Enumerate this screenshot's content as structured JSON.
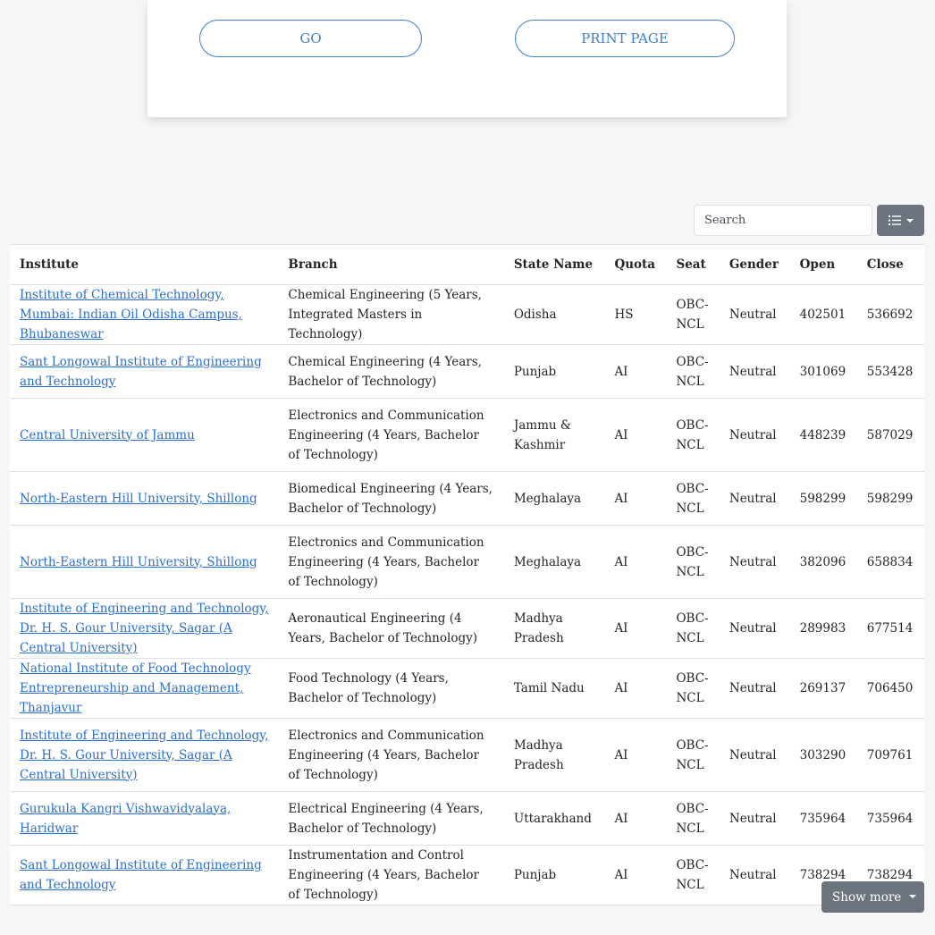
{
  "actions": {
    "go_label": "GO",
    "print_label": "PRINT PAGE"
  },
  "search": {
    "placeholder": "Search"
  },
  "table": {
    "headers": [
      "Institute",
      "Branch",
      "State Name",
      "Quota",
      "Seat",
      "Gender",
      "Open",
      "Close"
    ],
    "rows": [
      {
        "institute": "Institute of Chemical Technology, Mumbai: Indian Oil Odisha Campus, Bhubaneswar",
        "branch": "Chemical Engineering (5 Years, Integrated Masters in Technology)",
        "state": "Odisha",
        "quota": "HS",
        "seat": "OBC-NCL",
        "gender": "Neutral",
        "open": "402501",
        "close": "536692"
      },
      {
        "institute": "Sant Longowal Institute of Engineering and Technology",
        "branch": "Chemical Engineering (4 Years, Bachelor of Technology)",
        "state": "Punjab",
        "quota": "AI",
        "seat": "OBC-NCL",
        "gender": "Neutral",
        "open": "301069",
        "close": "553428"
      },
      {
        "institute": "Central University of Jammu",
        "branch": "Electronics and Communication Engineering (4 Years, Bachelor of Technology)",
        "state": "Jammu & Kashmir",
        "quota": "AI",
        "seat": "OBC-NCL",
        "gender": "Neutral",
        "open": "448239",
        "close": "587029"
      },
      {
        "institute": "North-Eastern Hill University, Shillong",
        "branch": "Biomedical Engineering (4 Years, Bachelor of Technology)",
        "state": "Meghalaya",
        "quota": "AI",
        "seat": "OBC-NCL",
        "gender": "Neutral",
        "open": "598299",
        "close": "598299"
      },
      {
        "institute": "North-Eastern Hill University, Shillong",
        "branch": "Electronics and Communication Engineering (4 Years, Bachelor of Technology)",
        "state": "Meghalaya",
        "quota": "AI",
        "seat": "OBC-NCL",
        "gender": "Neutral",
        "open": "382096",
        "close": "658834"
      },
      {
        "institute": "Institute of Engineering and Technology, Dr. H. S. Gour University, Sagar (A Central University)",
        "branch": "Aeronautical Engineering (4 Years, Bachelor of Technology)",
        "state": "Madhya Pradesh",
        "quota": "AI",
        "seat": "OBC-NCL",
        "gender": "Neutral",
        "open": "289983",
        "close": "677514"
      },
      {
        "institute": "National Institute of Food Technology Entrepreneurship and Management, Thanjavur",
        "branch": "Food Technology (4 Years, Bachelor of Technology)",
        "state": "Tamil Nadu",
        "quota": "AI",
        "seat": "OBC-NCL",
        "gender": "Neutral",
        "open": "269137",
        "close": "706450"
      },
      {
        "institute": "Institute of Engineering and Technology, Dr. H. S. Gour University, Sagar (A Central University)",
        "branch": "Electronics and Communication Engineering (4 Years, Bachelor of Technology)",
        "state": "Madhya Pradesh",
        "quota": "AI",
        "seat": "OBC-NCL",
        "gender": "Neutral",
        "open": "303290",
        "close": "709761"
      },
      {
        "institute": "Gurukula Kangri Vishwavidyalaya, Haridwar",
        "branch": "Electrical Engineering (4 Years, Bachelor of Technology)",
        "state": "Uttarakhand",
        "quota": "AI",
        "seat": "OBC-NCL",
        "gender": "Neutral",
        "open": "735964",
        "close": "735964"
      },
      {
        "institute": "Sant Longowal Institute of Engineering and Technology",
        "branch": "Instrumentation and Control Engineering (4 Years, Bachelor of Technology)",
        "state": "Punjab",
        "quota": "AI",
        "seat": "OBC-NCL",
        "gender": "Neutral",
        "open": "738294",
        "close": "738294"
      }
    ]
  },
  "footer": {
    "show_more_label": "Show more"
  },
  "icons": {
    "columns_button": "list-icon",
    "show_more": "caret-down-icon"
  },
  "colors": {
    "link": "#2a6fc9",
    "button_outline": "#3f7fc6",
    "secondary_button": "#6c757d"
  }
}
